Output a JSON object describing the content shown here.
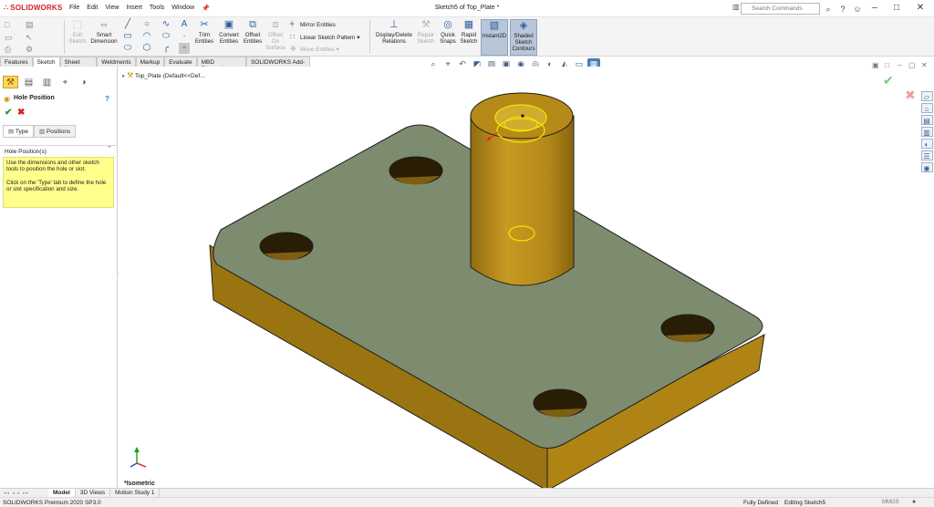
{
  "app": {
    "logo_text": "SOLIDWORKS",
    "document_title": "Sketch5 of Top_Plate *",
    "menus": [
      "File",
      "Edit",
      "View",
      "Insert",
      "Tools",
      "Window"
    ],
    "pin_icon": "pin-icon",
    "search_placeholder": "Search Commands"
  },
  "command_manager": {
    "exit_sketch": "Exit Sketch",
    "smart_dimension": "Smart Dimension",
    "trim_entities": "Trim Entities",
    "convert_entities": "Convert Entities",
    "offset_entities": "Offset Entities",
    "offset_on_surface": "Offset On Surface",
    "mirror_entities": "Mirror Entities",
    "linear_sketch_pattern": "Linear Sketch Pattern",
    "move_entities": "Move Entities",
    "display_delete_relations": "Display/Delete Relations",
    "repair_sketch": "Repair Sketch",
    "quick_snaps": "Quick Snaps",
    "rapid_sketch": "Rapid Sketch",
    "instant2d": "Instant2D",
    "shaded_sketch_contours": "Shaded Sketch Contours"
  },
  "tabs": [
    "Features",
    "Sketch",
    "Sheet Metal",
    "Weldments",
    "Markup",
    "Evaluate",
    "MBD Dimensions",
    "SOLIDWORKS Add-Ins"
  ],
  "active_tab": "Sketch",
  "property_manager": {
    "title": "Hole Position",
    "subtabs": [
      "Type",
      "Positions"
    ],
    "active_subtab": "Positions",
    "group_title": "Hole Position(s)",
    "help_text_1": "Use the dimensions and other sketch tools to position the hole or slot.",
    "help_text_2": "Click on the 'Type' tab to define the hole or slot specification and size."
  },
  "feature_tree": {
    "part_name": "Top_Plate",
    "configuration": "(Default<<Def..."
  },
  "viewport": {
    "view_name": "*Isometric"
  },
  "bottom_tabs": [
    "Model",
    "3D Views",
    "Motion Study 1"
  ],
  "active_bottom_tab": "Model",
  "status": {
    "product": "SOLIDWORKS Premium 2020 SP3.0",
    "sketch_state": "Fully Defined",
    "editing": "Editing Sketch5",
    "units": "MMGS"
  },
  "colors": {
    "plate_face": "#7d8b6f",
    "cylinder_body": "#b78a1a",
    "side_wall": "#9a7410",
    "sketch_highlight": "#f2e400",
    "help_background": "#ffff8c"
  }
}
